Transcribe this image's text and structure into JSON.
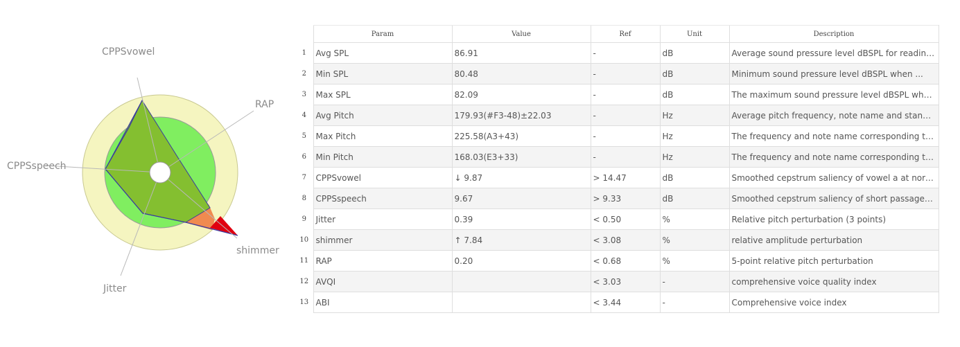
{
  "radar": {
    "axes": [
      "CPPSvowel",
      "RAP",
      "shimmer",
      "Jitter",
      "CPPSspeech"
    ],
    "colors": {
      "outer_ring": "#f5f5c0",
      "inner_ring": "#80ee60",
      "data_fill": "#84bf30",
      "exceed_orange": "#f08a50",
      "exceed_red": "#e00010",
      "outline": "#3a3aa0",
      "axis_line": "#b8b8b8"
    }
  },
  "table": {
    "headers": {
      "param": "Param",
      "value": "Value",
      "ref": "Ref",
      "unit": "Unit",
      "description": "Description"
    },
    "rows": [
      {
        "idx": "1",
        "param": "Avg SPL",
        "value": "86.91",
        "ref": "-",
        "unit": "dB",
        "description": "Average sound pressure level dBSPL for reading..."
      },
      {
        "idx": "2",
        "param": "Min SPL",
        "value": "80.48",
        "ref": "-",
        "unit": "dB",
        "description": "Minimum sound pressure level dBSPL when ..."
      },
      {
        "idx": "3",
        "param": "Max SPL",
        "value": "82.09",
        "ref": "-",
        "unit": "dB",
        "description": "The maximum sound pressure level dBSPL when ..."
      },
      {
        "idx": "4",
        "param": "Avg Pitch",
        "value": "179.93(#F3-48)±22.03",
        "ref": "-",
        "unit": "Hz",
        "description": "Average pitch frequency, note name and standa..."
      },
      {
        "idx": "5",
        "param": "Max Pitch",
        "value": "225.58(A3+43)",
        "ref": "-",
        "unit": "Hz",
        "description": "The frequency and note name corresponding to ..."
      },
      {
        "idx": "6",
        "param": "Min Pitch",
        "value": "168.03(E3+33)",
        "ref": "-",
        "unit": "Hz",
        "description": "The frequency and note name corresponding to ..."
      },
      {
        "idx": "7",
        "param": "CPPSvowel",
        "value": "↓ 9.87",
        "ref": "> 14.47",
        "unit": "dB",
        "description": "Smoothed cepstrum saliency of vowel a at norm..."
      },
      {
        "idx": "8",
        "param": "CPPSspeech",
        "value": "9.67",
        "ref": "> 9.33",
        "unit": "dB",
        "description": "Smoothed cepstrum saliency of short passages ..."
      },
      {
        "idx": "9",
        "param": "Jitter",
        "value": "0.39",
        "ref": "< 0.50",
        "unit": "%",
        "description": "Relative pitch perturbation (3 points)"
      },
      {
        "idx": "10",
        "param": "shimmer",
        "value": "↑ 7.84",
        "ref": "< 3.08",
        "unit": "%",
        "description": "relative amplitude perturbation"
      },
      {
        "idx": "11",
        "param": "RAP",
        "value": "0.20",
        "ref": "< 0.68",
        "unit": "%",
        "description": "5-point relative pitch perturbation"
      },
      {
        "idx": "12",
        "param": "AVQI",
        "value": "",
        "ref": "< 3.03",
        "unit": "-",
        "description": "comprehensive voice quality index"
      },
      {
        "idx": "13",
        "param": "ABI",
        "value": "",
        "ref": "< 3.44",
        "unit": "-",
        "description": "Comprehensive voice index"
      }
    ]
  }
}
